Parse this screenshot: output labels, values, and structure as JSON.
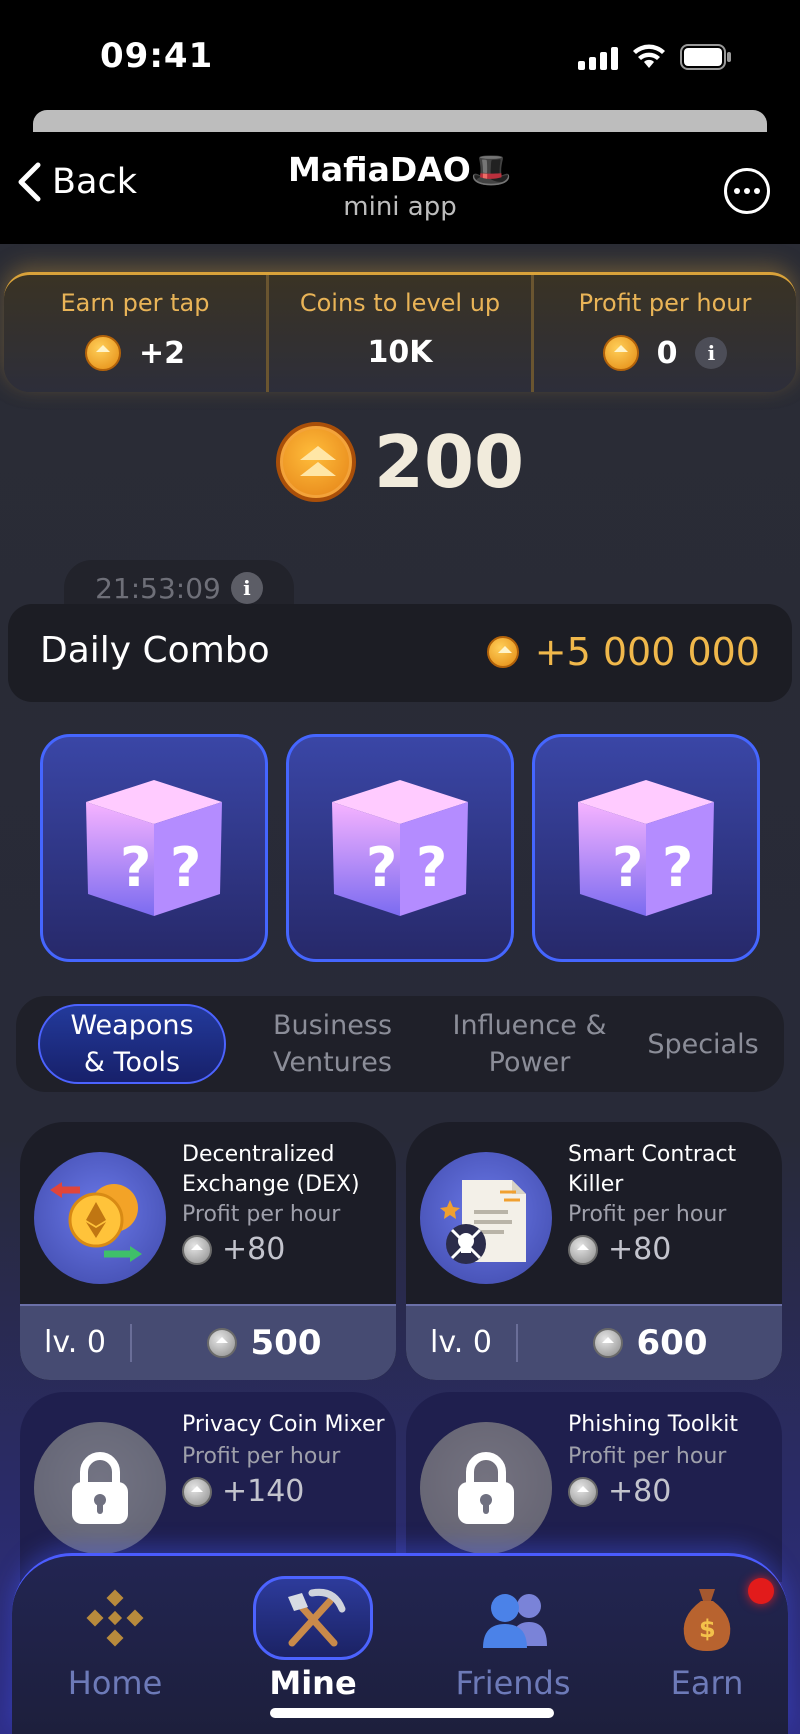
{
  "status_bar": {
    "time": "09:41"
  },
  "telegram": {
    "back_label": "Back",
    "title": "MafiaDAO🎩",
    "subtitle": "mini app"
  },
  "stats": [
    {
      "label": "Earn per tap",
      "value": "+2",
      "icon": "gold-coin-icon"
    },
    {
      "label": "Coins to level up",
      "value": "10K"
    },
    {
      "label": "Profit per hour",
      "value": "0",
      "icon": "gold-coin-icon"
    }
  ],
  "balance": {
    "value": "200"
  },
  "daily_combo": {
    "timer": "21:53:09",
    "title": "Daily Combo",
    "reward": "+5 000 000",
    "cards": [
      "mystery-box",
      "mystery-box",
      "mystery-box"
    ]
  },
  "category_tabs": [
    {
      "line1": "Weapons",
      "line2": "& Tools",
      "active": true
    },
    {
      "line1": "Business",
      "line2": "Ventures",
      "active": false
    },
    {
      "line1": "Influence &",
      "line2": "Power",
      "active": false
    },
    {
      "line1": "Specials",
      "line2": "",
      "active": false
    }
  ],
  "items": [
    {
      "name": "Decentralized Exchange (DEX)",
      "sub": "Profit per hour",
      "profit": "+80",
      "level": "lv. 0",
      "price": "500",
      "locked": false
    },
    {
      "name": "Smart Contract Killer",
      "sub": "Profit per hour",
      "profit": "+80",
      "level": "lv. 0",
      "price": "600",
      "locked": false
    },
    {
      "name": "Privacy Coin Mixer",
      "sub": "Profit per hour",
      "profit": "+140",
      "locked": true
    },
    {
      "name": "Phishing Toolkit",
      "sub": "Profit per hour",
      "profit": "+80",
      "locked": true
    }
  ],
  "nav": [
    {
      "label": "Home",
      "icon": "binance-icon",
      "active": false
    },
    {
      "label": "Mine",
      "icon": "pickaxe-shovel-icon",
      "active": true
    },
    {
      "label": "Friends",
      "icon": "friends-icon",
      "active": false
    },
    {
      "label": "Earn",
      "icon": "money-bag-icon",
      "active": false
    }
  ],
  "colors": {
    "accent_blue": "#4c63ff",
    "gold": "#f0b84b",
    "stat_label": "#e9b457"
  }
}
